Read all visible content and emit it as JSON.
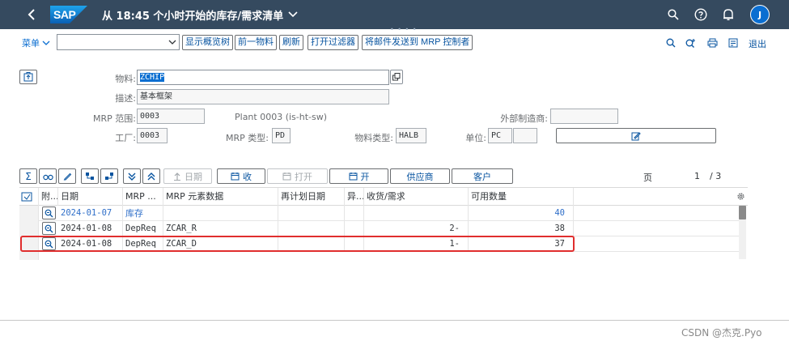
{
  "shell": {
    "logo": "SAP",
    "title": "从 18:45 个小时开始的库存/需求清单",
    "avatar_initial": "J",
    "icons": [
      "search-icon",
      "help-icon",
      "bell-icon"
    ]
  },
  "toolbar": {
    "menu_label": "菜单",
    "combo_value": "",
    "buttons": [
      "显示概览树",
      "前一物料",
      "刷新",
      "打开过滤器",
      "将邮件发送到 MRP 控制者"
    ],
    "exit_label": "退出"
  },
  "form": {
    "material_label": "物料:",
    "material_value": "ZCHIP",
    "desc_label": "描述:",
    "desc_value": "基本框架",
    "mrp_area_label": "MRP 范围:",
    "mrp_area_value": "0003",
    "mrp_area_text": "Plant 0003 (is-ht-sw)",
    "ext_label": "外部制造商:",
    "ext_value": "",
    "plant_label": "工厂:",
    "plant_value": "0003",
    "mrp_type_label": "MRP 类型:",
    "mrp_type_value": "PD",
    "mat_type_label": "物料类型:",
    "mat_type_value": "HALB",
    "unit_label": "单位:",
    "unit_value": "PC",
    "unit_extra": ""
  },
  "grid_toolbar": {
    "date_label": "日期",
    "receive_label": "收",
    "open_label": "打开",
    "open2_label": "开",
    "vendor_label": "供应商",
    "customer_label": "客户",
    "page_label": "页",
    "page_current": "1",
    "page_total": "/ 3"
  },
  "table": {
    "headers": [
      "附...",
      "日期",
      "MRP ...",
      "MRP 元素数据",
      "再计划日期",
      "异...",
      "收货/需求",
      "可用数量"
    ],
    "rows": [
      {
        "date": "2024-01-07",
        "mrp": "库存",
        "data": "",
        "reschedule": "",
        "exc": "",
        "qty": "",
        "avail": "40"
      },
      {
        "date": "2024-01-08",
        "mrp": "DepReq",
        "data": "ZCAR_R",
        "reschedule": "",
        "exc": "",
        "qty": "2-",
        "avail": "38"
      },
      {
        "date": "2024-01-08",
        "mrp": "DepReq",
        "data": "ZCAR_D",
        "reschedule": "",
        "exc": "",
        "qty": "1-",
        "avail": "37"
      }
    ]
  },
  "watermark": "CSDN @杰克.Pyo",
  "colors": {
    "shell_bg": "#354a5f",
    "link": "#0854a0",
    "highlight": "#e02e2e"
  }
}
